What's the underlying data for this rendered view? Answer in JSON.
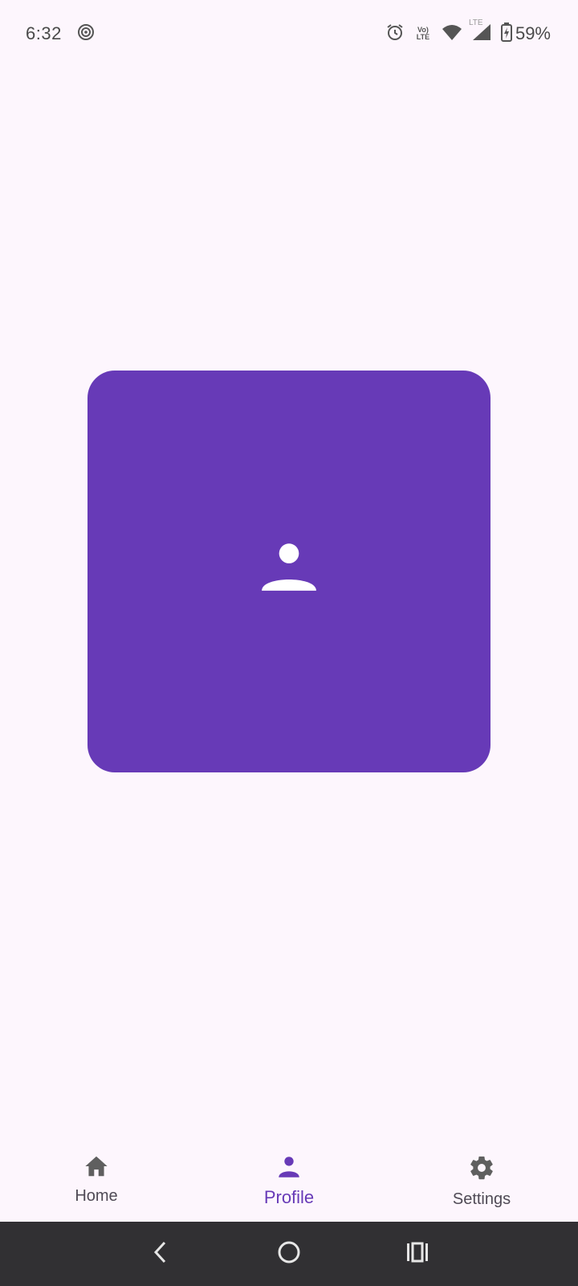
{
  "status_bar": {
    "time": "6:32",
    "volte_top": "Vo)",
    "volte_bottom": "LTE",
    "lte_label": "LTE",
    "battery": "59%",
    "icons": [
      "hotspot-icon",
      "alarm-icon",
      "volte-icon",
      "wifi-icon",
      "lte-signal-icon",
      "battery-charging-icon"
    ]
  },
  "card": {
    "icon": "person-icon",
    "color": "#673ab7"
  },
  "bottom_nav": {
    "items": [
      {
        "label": "Home",
        "icon": "home-icon",
        "active": false
      },
      {
        "label": "Profile",
        "icon": "person-icon",
        "active": true
      },
      {
        "label": "Settings",
        "icon": "gear-icon",
        "active": false
      }
    ]
  },
  "system_nav": {
    "buttons": [
      "back-icon",
      "home-circle-icon",
      "recents-icon"
    ]
  },
  "colors": {
    "accent": "#673ab7",
    "background": "#fdf6fd",
    "system_nav_bg": "#313033",
    "inactive": "#5f5f5f"
  }
}
